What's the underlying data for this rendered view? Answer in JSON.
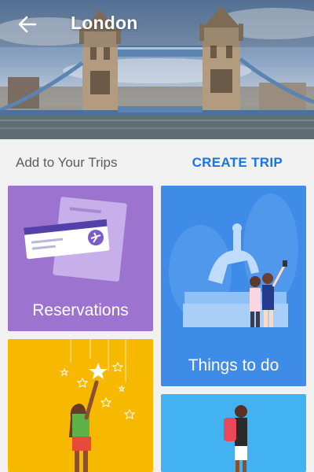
{
  "header": {
    "title": "London",
    "back_icon": "arrow-left-icon"
  },
  "section": {
    "label": "Add to Your Trips",
    "action": "CREATE TRIP"
  },
  "cards": [
    {
      "label": "Reservations",
      "color": "#9c74cf",
      "icon": "ticket-airplane-icon"
    },
    {
      "label": "Things to do",
      "color": "#3f8ce8",
      "icon": "statue-selfie-icon"
    },
    {
      "label": "",
      "color": "#f7b900",
      "icon": "stars-reaching-icon"
    },
    {
      "label": "",
      "color": "#42b3f0",
      "icon": "walking-traveler-icon"
    }
  ],
  "colors": {
    "accent": "#1a73e8",
    "background": "#f1f1f1"
  }
}
